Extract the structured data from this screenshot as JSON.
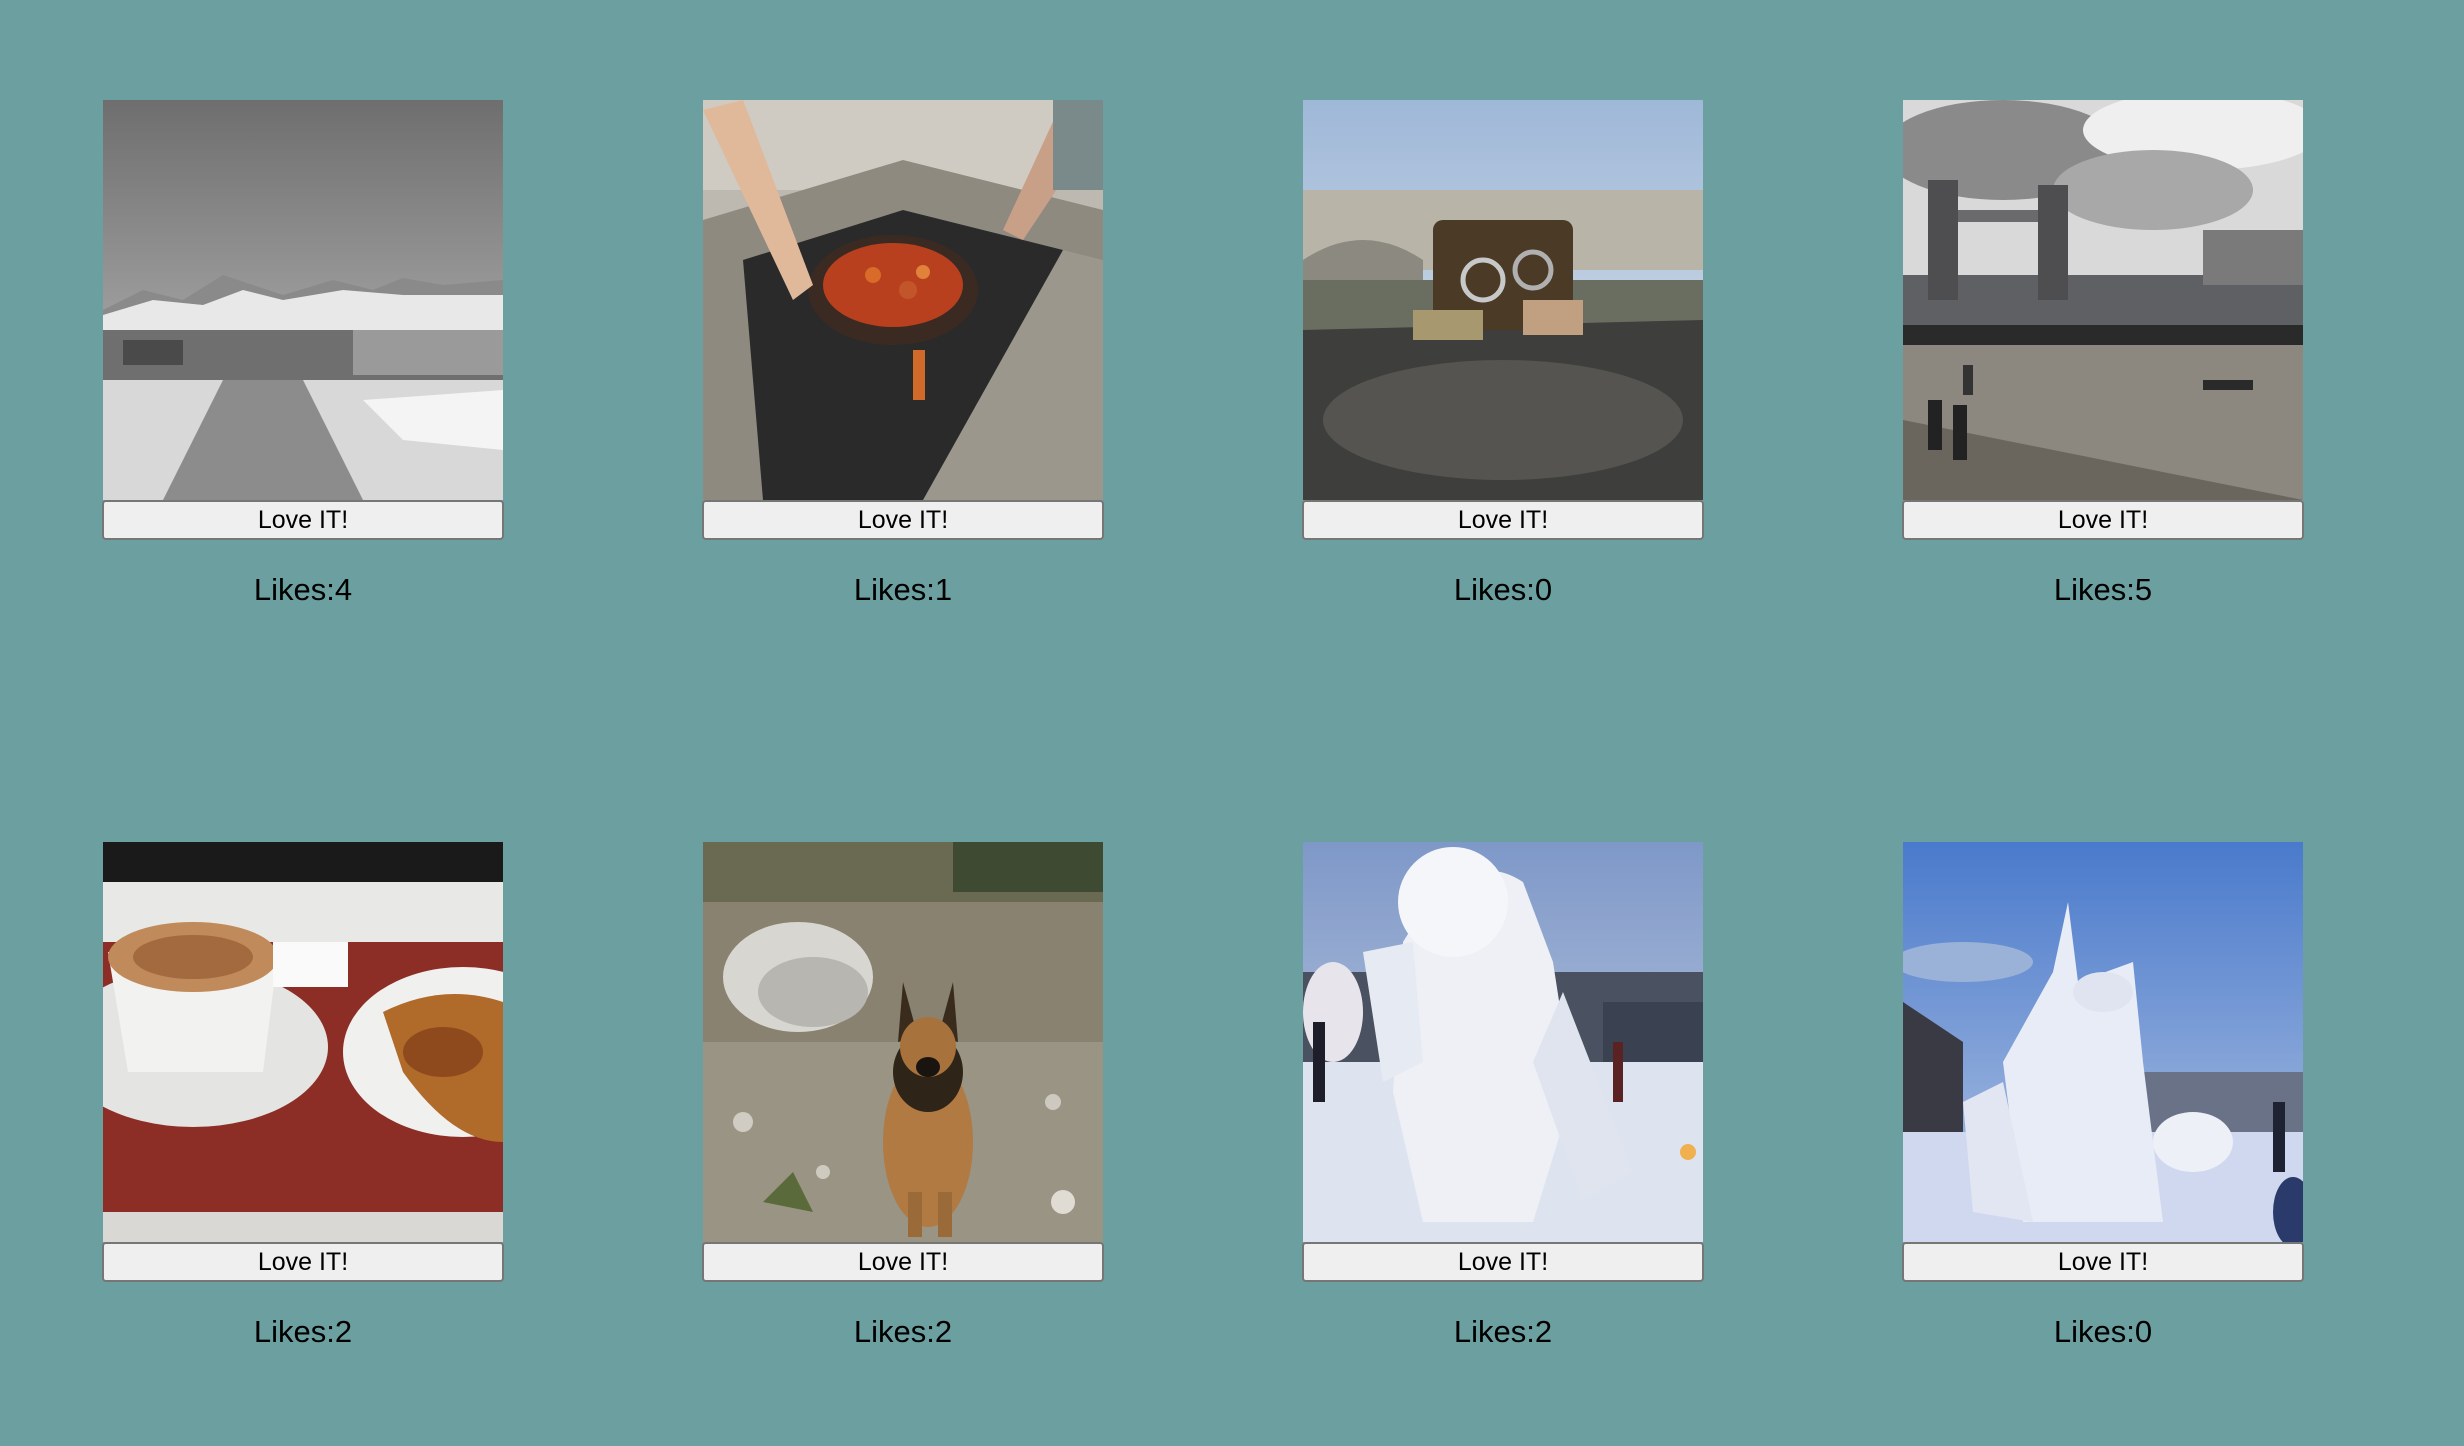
{
  "posts": [
    {
      "photo": "mountain-snow-photo",
      "button_label": "Love IT!",
      "likes_label": "Likes:",
      "likes": "4"
    },
    {
      "photo": "paella-fire-pit-photo",
      "button_label": "Love IT!",
      "likes_label": "Likes:",
      "likes": "1"
    },
    {
      "photo": "bridge-padlocks-photo",
      "button_label": "Love IT!",
      "likes_label": "Likes:",
      "likes": "0"
    },
    {
      "photo": "tower-bridge-photo",
      "button_label": "Love IT!",
      "likes_label": "Likes:",
      "likes": "5"
    },
    {
      "photo": "coffee-pastry-photo",
      "button_label": "Love IT!",
      "likes_label": "Likes:",
      "likes": "2"
    },
    {
      "photo": "german-shepherd-photo",
      "button_label": "Love IT!",
      "likes_label": "Likes:",
      "likes": "2"
    },
    {
      "photo": "snow-sculpture-dusk-photo",
      "button_label": "Love IT!",
      "likes_label": "Likes:",
      "likes": "2"
    },
    {
      "photo": "snow-sculpture-blue-sky-photo",
      "button_label": "Love IT!",
      "likes_label": "Likes:",
      "likes": "0"
    }
  ],
  "colors": {
    "background": "#6b9fa0",
    "button_background": "#efefef",
    "button_border": "#767676"
  }
}
